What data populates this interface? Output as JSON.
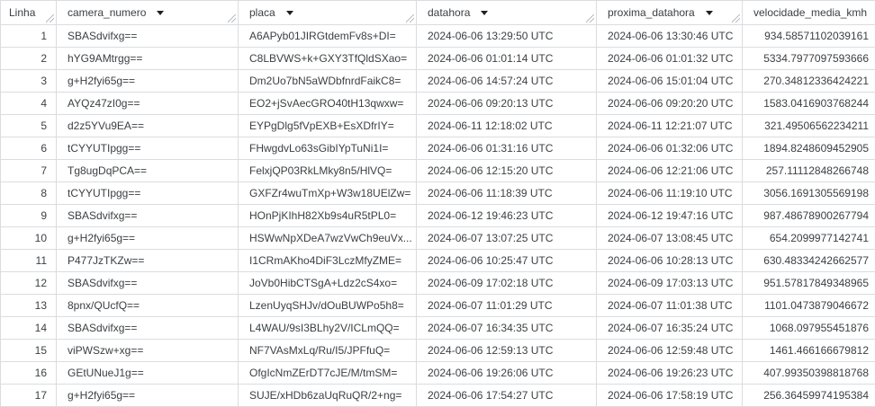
{
  "columns": {
    "linha": "Linha",
    "camera_numero": "camera_numero",
    "placa": "placa",
    "datahora": "datahora",
    "proxima_datahora": "proxima_datahora",
    "velocidade_media_kmh": "velocidade_media_kmh"
  },
  "icons": {
    "sort": "sort-arrow-down-icon",
    "resize": "column-resize-icon"
  },
  "rows": [
    {
      "linha": "1",
      "camera_numero": "SBASdvifxg==",
      "placa": "A6APyb01JIRGtdemFv8s+DI=",
      "datahora": "2024-06-06 13:29:50 UTC",
      "proxima_datahora": "2024-06-06 13:30:46 UTC",
      "velocidade_media_kmh": "934.58571102039161"
    },
    {
      "linha": "2",
      "camera_numero": "hYG9AMtrgg==",
      "placa": "C8LBVWS+k+GXY3TfQldSXao=",
      "datahora": "2024-06-06 01:01:14 UTC",
      "proxima_datahora": "2024-06-06 01:01:32 UTC",
      "velocidade_media_kmh": "5334.7977097593666"
    },
    {
      "linha": "3",
      "camera_numero": "g+H2fyi65g==",
      "placa": "Dm2Uo7bN5aWDbfnrdFaikC8=",
      "datahora": "2024-06-06 14:57:24 UTC",
      "proxima_datahora": "2024-06-06 15:01:04 UTC",
      "velocidade_media_kmh": "270.34812336424221"
    },
    {
      "linha": "4",
      "camera_numero": "AYQz47zI0g==",
      "placa": "EO2+jSvAecGRO40tH13qwxw=",
      "datahora": "2024-06-06 09:20:13 UTC",
      "proxima_datahora": "2024-06-06 09:20:20 UTC",
      "velocidade_media_kmh": "1583.0416903768244"
    },
    {
      "linha": "5",
      "camera_numero": "d2z5YVu9EA==",
      "placa": "EYPgDlg5fVpEXB+EsXDfrIY=",
      "datahora": "2024-06-11 12:18:02 UTC",
      "proxima_datahora": "2024-06-11 12:21:07 UTC",
      "velocidade_media_kmh": "321.49506562234211"
    },
    {
      "linha": "6",
      "camera_numero": "tCYYUTIpgg==",
      "placa": "FHwgdvLo63sGibIYpTuNi1I=",
      "datahora": "2024-06-06 01:31:16 UTC",
      "proxima_datahora": "2024-06-06 01:32:06 UTC",
      "velocidade_media_kmh": "1894.8248609452905"
    },
    {
      "linha": "7",
      "camera_numero": "Tg8ugDqPCA==",
      "placa": "FelxjQP03RkLMky8n5/HlVQ=",
      "datahora": "2024-06-06 12:15:20 UTC",
      "proxima_datahora": "2024-06-06 12:21:06 UTC",
      "velocidade_media_kmh": "257.11112848266748"
    },
    {
      "linha": "8",
      "camera_numero": "tCYYUTIpgg==",
      "placa": "GXFZr4wuTmXp+W3w18UElZw=",
      "datahora": "2024-06-06 11:18:39 UTC",
      "proxima_datahora": "2024-06-06 11:19:10 UTC",
      "velocidade_media_kmh": "3056.1691305569198"
    },
    {
      "linha": "9",
      "camera_numero": "SBASdvifxg==",
      "placa": "HOnPjKIhH82Xb9s4uR5tPL0=",
      "datahora": "2024-06-12 19:46:23 UTC",
      "proxima_datahora": "2024-06-12 19:47:16 UTC",
      "velocidade_media_kmh": "987.48678900267794"
    },
    {
      "linha": "10",
      "camera_numero": "g+H2fyi65g==",
      "placa": "HSWwNpXDeA7wzVwCh9euVx...",
      "datahora": "2024-06-07 13:07:25 UTC",
      "proxima_datahora": "2024-06-07 13:08:45 UTC",
      "velocidade_media_kmh": "654.2099977142741"
    },
    {
      "linha": "11",
      "camera_numero": "P477JzTKZw==",
      "placa": "I1CRmAKho4DiF3LczMfyZME=",
      "datahora": "2024-06-06 10:25:47 UTC",
      "proxima_datahora": "2024-06-06 10:28:13 UTC",
      "velocidade_media_kmh": "630.48334242662577"
    },
    {
      "linha": "12",
      "camera_numero": "SBASdvifxg==",
      "placa": "JoVb0HibCTSgA+Ldz2cS4xo=",
      "datahora": "2024-06-09 17:02:18 UTC",
      "proxima_datahora": "2024-06-09 17:03:13 UTC",
      "velocidade_media_kmh": "951.57817849348965"
    },
    {
      "linha": "13",
      "camera_numero": "8pnx/QUcfQ==",
      "placa": "LzenUyqSHJv/dOuBUWPo5h8=",
      "datahora": "2024-06-07 11:01:29 UTC",
      "proxima_datahora": "2024-06-07 11:01:38 UTC",
      "velocidade_media_kmh": "1101.0473879046672"
    },
    {
      "linha": "14",
      "camera_numero": "SBASdvifxg==",
      "placa": "L4WAU/9sI3BLhy2V/ICLmQQ=",
      "datahora": "2024-06-07 16:34:35 UTC",
      "proxima_datahora": "2024-06-07 16:35:24 UTC",
      "velocidade_media_kmh": "1068.097955451876"
    },
    {
      "linha": "15",
      "camera_numero": "viPWSzw+xg==",
      "placa": "NF7VAsMxLq/Ru/I5/JPFfuQ=",
      "datahora": "2024-06-06 12:59:13 UTC",
      "proxima_datahora": "2024-06-06 12:59:48 UTC",
      "velocidade_media_kmh": "1461.466166679812"
    },
    {
      "linha": "16",
      "camera_numero": "GEtUNueJ1g==",
      "placa": "OfgIcNmZErDT7cJE/M/tmSM=",
      "datahora": "2024-06-06 19:26:06 UTC",
      "proxima_datahora": "2024-06-06 19:26:23 UTC",
      "velocidade_media_kmh": "407.99350398818768"
    },
    {
      "linha": "17",
      "camera_numero": "g+H2fyi65g==",
      "placa": "SUJE/xHDb6zaUqRuQR/2+ng=",
      "datahora": "2024-06-06 17:54:27 UTC",
      "proxima_datahora": "2024-06-06 17:58:19 UTC",
      "velocidade_media_kmh": "256.36459974195384"
    }
  ]
}
